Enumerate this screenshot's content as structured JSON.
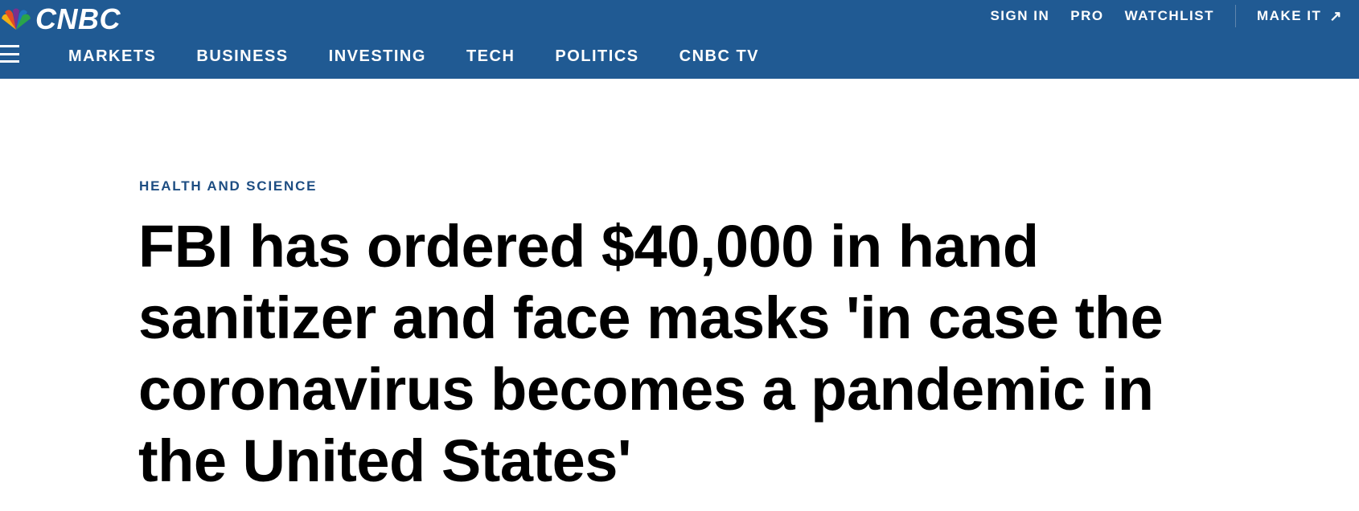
{
  "header": {
    "logo_text": "CNBC",
    "utility_links": [
      {
        "label": "SIGN IN"
      },
      {
        "label": "PRO"
      },
      {
        "label": "WATCHLIST"
      }
    ],
    "make_it": {
      "label": "MAKE IT",
      "icon": "external-arrow-icon",
      "arrow_glyph": "↗"
    },
    "menu_icon": "hamburger-icon",
    "nav": [
      {
        "label": "MARKETS"
      },
      {
        "label": "BUSINESS"
      },
      {
        "label": "INVESTING"
      },
      {
        "label": "TECH"
      },
      {
        "label": "POLITICS"
      },
      {
        "label": "CNBC TV"
      }
    ],
    "background_color": "#205a93"
  },
  "article": {
    "section": "HEALTH AND SCIENCE",
    "headline_lines": [
      "FBI has ordered $40,000 in hand",
      "sanitizer and face masks 'in case the",
      "coronavirus becomes a pandemic in",
      "the United States'"
    ],
    "section_color": "#1d4d82"
  }
}
